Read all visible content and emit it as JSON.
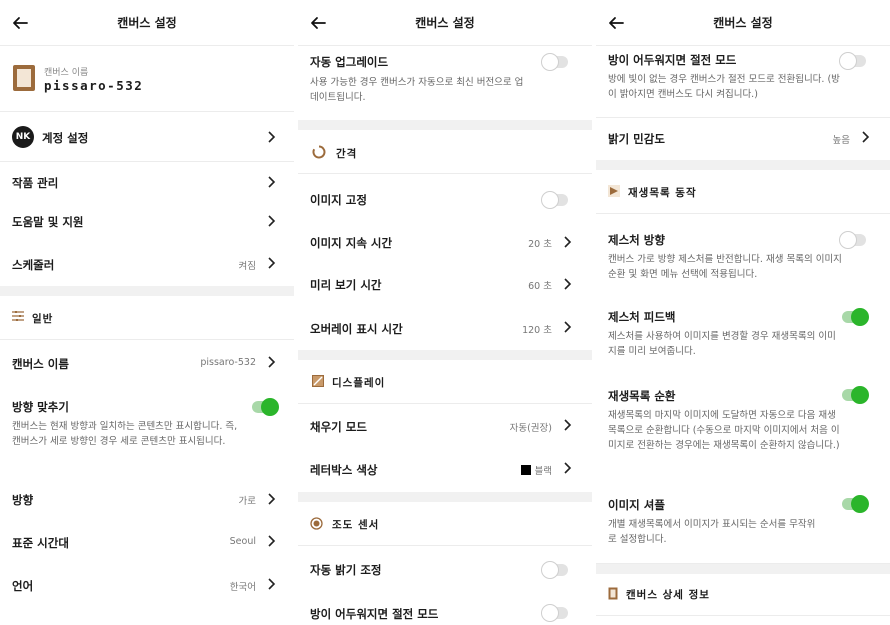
{
  "app": {
    "title": "캔버스 설정"
  },
  "colors": {
    "accent_green": "#2bb52b",
    "brown": "#9c6b3c",
    "divider": "#f1f1f1"
  },
  "panel1": {
    "canvas_card": {
      "caption": "캔버스 이름",
      "name": "pissaro-532",
      "icon": "canvas-frame-icon"
    },
    "account": {
      "avatar": "NK",
      "label": "계정 설정"
    },
    "nav": [
      {
        "label": "작품 관리"
      },
      {
        "label": "도움말 및 지원"
      },
      {
        "label": "스케줄러",
        "value": "켜짐"
      }
    ],
    "section": {
      "title": "일반",
      "icon": "sliders-icon"
    },
    "canvas_name": {
      "label": "캔버스 이름",
      "value": "pissaro-532"
    },
    "orientation_match": {
      "label": "방향 맞추기",
      "desc": "캔버스는 현재 방향과 일치하는 콘텐츠만 표시합니다. 즉, 캔버스가 세로 방향인 경우 세로 콘텐츠만 표시됩니다.",
      "on": true
    },
    "settings": [
      {
        "label": "방향",
        "value": "가로"
      },
      {
        "label": "표준 시간대",
        "value": "Seoul"
      },
      {
        "label": "언어",
        "value": "한국어"
      }
    ]
  },
  "panel2": {
    "auto_upgrade": {
      "label": "자동 업그레이드",
      "desc": "사용 가능한 경우 캔버스가 자동으로 최신 버전으로 업데이트됩니다.",
      "on": false
    },
    "interval_section": {
      "title": "간격",
      "icon": "timer-icon"
    },
    "image_pin": {
      "label": "이미지 고정",
      "on": false
    },
    "interval_rows": [
      {
        "label": "이미지 지속 시간",
        "value": "20 초"
      },
      {
        "label": "미리 보기 시간",
        "value": "60 초"
      },
      {
        "label": "오버레이 표시 시간",
        "value": "120 초"
      }
    ],
    "display_section": {
      "title": "디스플레이",
      "icon": "display-icon"
    },
    "fill_mode": {
      "label": "채우기 모드",
      "value": "자동(권장)"
    },
    "letterbox": {
      "label": "레터박스 색상",
      "value": "블랙"
    },
    "sensor_section": {
      "title": "조도 센서",
      "icon": "sensor-icon"
    },
    "auto_brightness": {
      "label": "자동 밝기 조정",
      "on": false
    },
    "dark_power_save": {
      "label": "방이 어두워지면 절전 모드",
      "on": false
    }
  },
  "panel3": {
    "dark_power_save": {
      "label": "방이 어두워지면 절전 모드",
      "desc": "방에 빛이 없는 경우 캔버스가 절전 모드로 전환됩니다. (방이 밝아지면 캔버스도 다시 켜집니다.)",
      "on": false
    },
    "brightness_sensitivity": {
      "label": "밝기 민감도",
      "value": "높음"
    },
    "playlist_section": {
      "title": "재생목록 동작",
      "icon": "playlist-icon"
    },
    "gesture_direction": {
      "label": "제스처 방향",
      "desc": "캔버스 가로 방향 제스처를 반전합니다. 재생 목록의 이미지 순환 및 화면 메뉴 선택에 적용됩니다.",
      "on": false
    },
    "gesture_feedback": {
      "label": "제스처 피드백",
      "desc": "제스처를 사용하여 이미지를 변경할 경우 재생목록의 이미지를 미리 보여줍니다.",
      "on": true
    },
    "playlist_loop": {
      "label": "재생목록 순환",
      "desc": "재생목록의 마지막 이미지에 도달하면 자동으로 다음 재생목록으로 순환합니다 (수동으로 마지막 이미지에서 처음 이미지로 전환하는 경우에는 재생목록이 순환하지 않습니다.)",
      "on": true
    },
    "image_shuffle": {
      "label": "이미지 셔플",
      "desc": "개별 재생목록에서 이미지가 표시되는 순서를 무작위로 설정합니다.",
      "on": true
    },
    "details_section": {
      "title": "캔버스 상세 정보",
      "icon": "canvas-frame-icon"
    }
  }
}
